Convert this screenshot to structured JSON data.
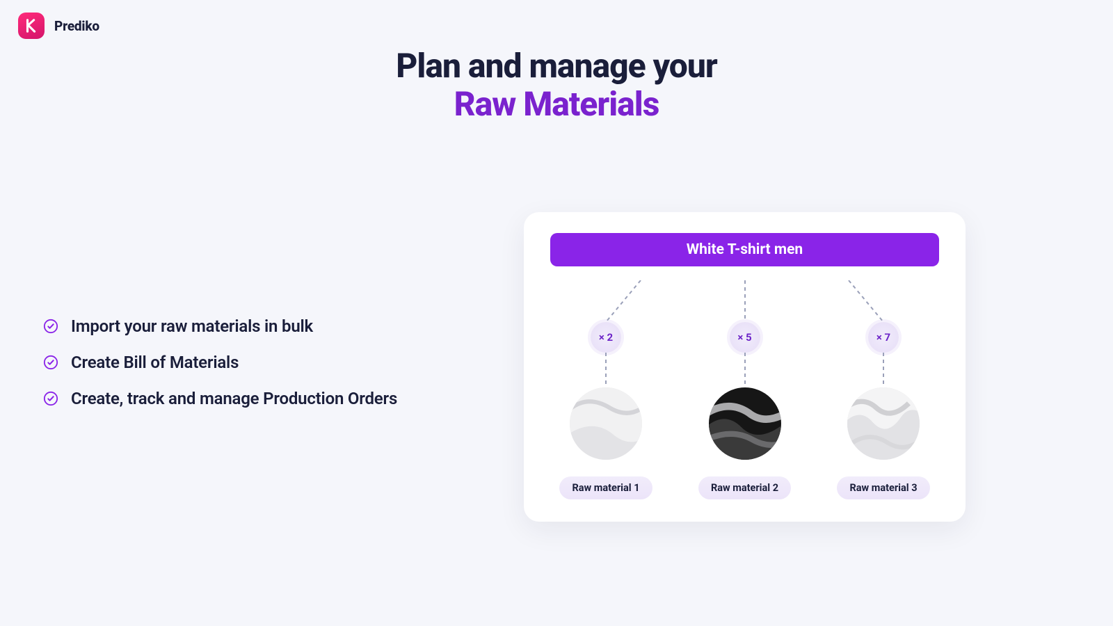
{
  "brand": {
    "name": "Prediko"
  },
  "headline": {
    "line1": "Plan and manage your",
    "line2": "Raw Materials"
  },
  "bullets": [
    "Import your raw materials in bulk",
    "Create Bill of Materials",
    "Create, track and manage Production Orders"
  ],
  "card": {
    "product": "White T-shirt men",
    "materials": [
      {
        "qty": "× 2",
        "label": "Raw material 1"
      },
      {
        "qty": "× 5",
        "label": "Raw material 2"
      },
      {
        "qty": "× 7",
        "label": "Raw material 3"
      }
    ]
  },
  "colors": {
    "accent": "#7a22ce",
    "brand_pink": "#ff2a7a"
  }
}
